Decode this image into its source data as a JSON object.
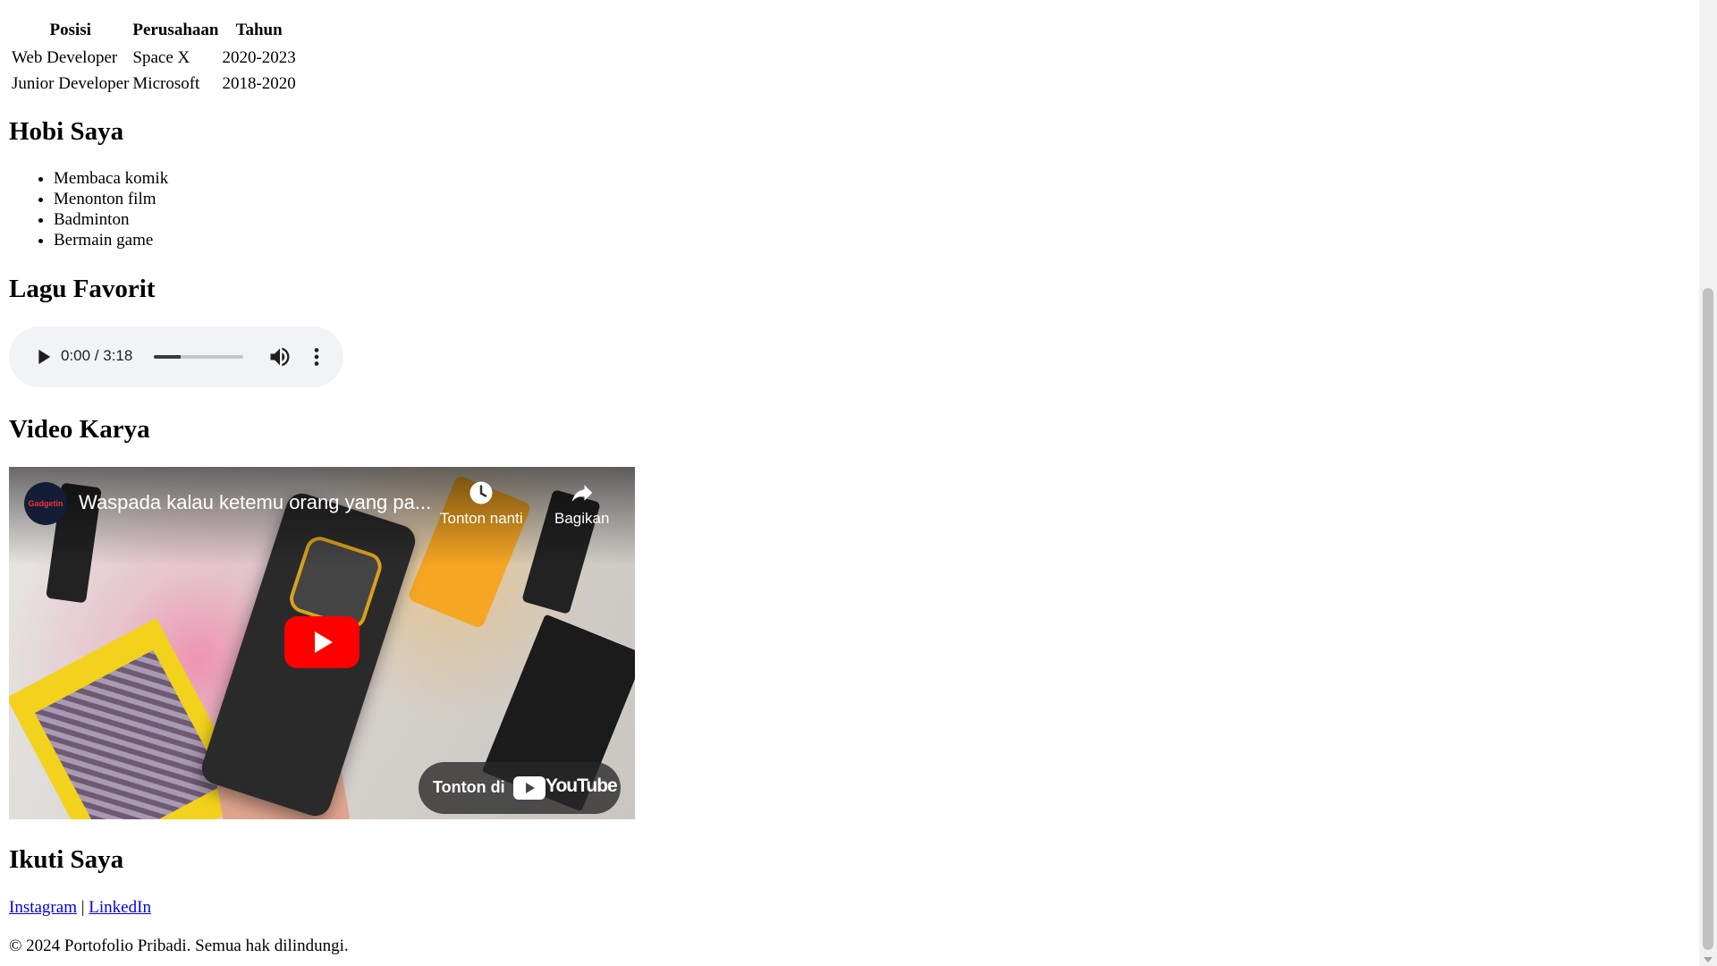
{
  "experience_table": {
    "headers": [
      "Posisi",
      "Perusahaan",
      "Tahun"
    ],
    "rows": [
      [
        "Web Developer",
        "Space X",
        "2020-2023"
      ],
      [
        "Junior Developer",
        "Microsoft",
        "2018-2020"
      ]
    ]
  },
  "hobbies": {
    "title": "Hobi Saya",
    "items": [
      "Membaca komik",
      "Menonton film",
      "Badminton",
      "Bermain game"
    ]
  },
  "music": {
    "title": "Lagu Favorit",
    "time": "0:00 / 3:18",
    "volume_fraction": 0.3,
    "icons": {
      "play": "play-icon",
      "volume": "volume-icon",
      "more": "more-vert-icon"
    }
  },
  "video": {
    "title": "Video Karya",
    "video_title": "Waspada kalau ketemu orang yang pa...",
    "channel_avatar_text": "Gadgetin",
    "watch_later": "Tonton nanti",
    "share": "Bagikan",
    "watch_on": "Tonton di",
    "youtube_word": "YouTube",
    "colors": {
      "youtube_red": "#ff0000"
    }
  },
  "social": {
    "title": "Ikuti Saya",
    "links": [
      "Instagram",
      "LinkedIn"
    ],
    "separator": "|"
  },
  "footer": {
    "text": "© 2024 Portofolio Pribadi. Semua hak dilindungi."
  }
}
